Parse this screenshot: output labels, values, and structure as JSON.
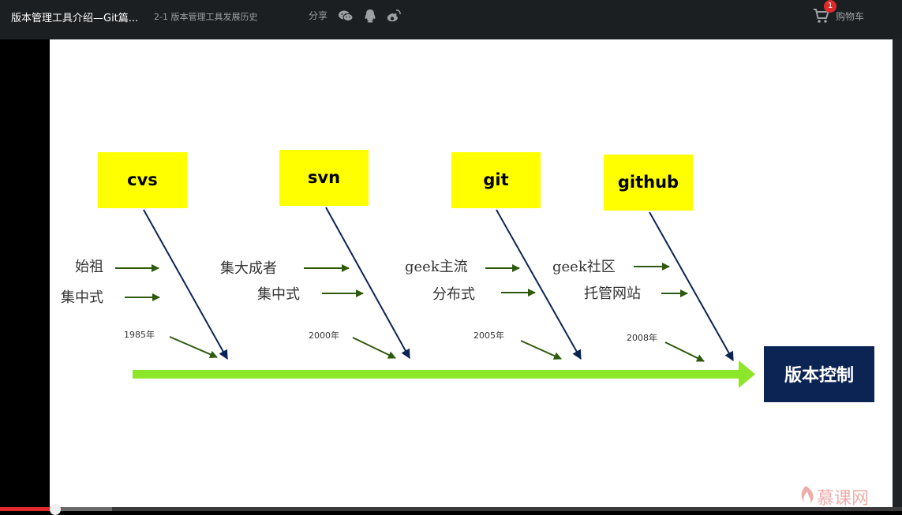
{
  "header": {
    "course_title": "版本管理工具介绍—Git篇...",
    "lesson_title": "2-1 版本管理工具发展历史",
    "share_label": "分享",
    "share_icons": [
      "wechat-icon",
      "qq-icon",
      "weibo-icon"
    ],
    "cart": {
      "label": "购物车",
      "badge": "1"
    }
  },
  "slide": {
    "tools": [
      {
        "name": "cvs",
        "notes": [
          "始祖",
          "集中式"
        ],
        "year": "1985年"
      },
      {
        "name": "svn",
        "notes": [
          "集大成者",
          "集中式"
        ],
        "year": "2000年"
      },
      {
        "name": "git",
        "notes": [
          "geek主流",
          "分布式"
        ],
        "year": "2005年"
      },
      {
        "name": "github",
        "notes": [
          "geek社区",
          "托管网站"
        ],
        "year": "2008年"
      }
    ],
    "target": "版本控制",
    "watermark": "慕课网",
    "colors": {
      "tool_box": "#ffff00",
      "spine": "#8ce62a",
      "target_box": "#0c2454",
      "arrow": "#0c2454",
      "note_arrow": "#2e5a0e"
    }
  },
  "player": {
    "progress_played": 0.061,
    "progress_buffered": 0.124
  }
}
